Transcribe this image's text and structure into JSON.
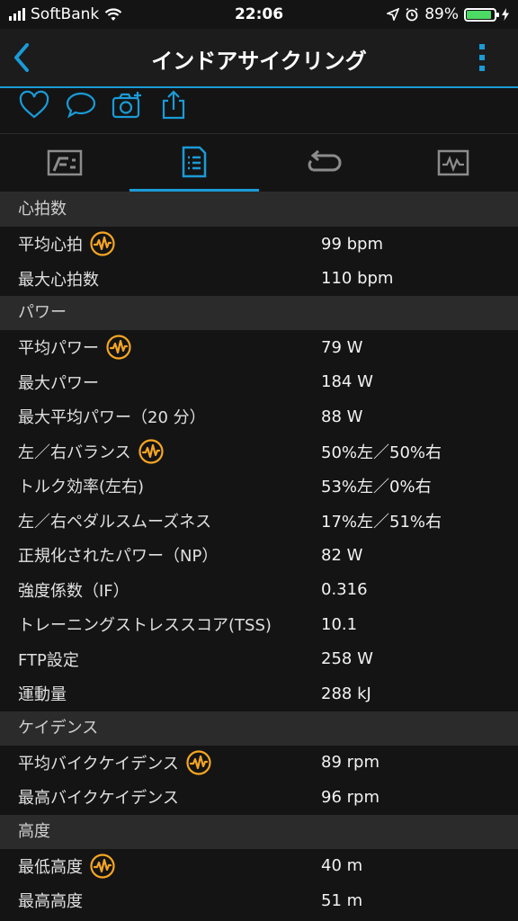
{
  "status_bar": {
    "carrier": "SoftBank",
    "time": "22:06",
    "battery": "89%"
  },
  "nav": {
    "title": "インドアサイクリング"
  },
  "icons": {
    "back": "chevron-left-icon",
    "more": "more-vertical-icon",
    "like": "heart-icon",
    "comment": "speech-bubble-icon",
    "photo": "add-photo-icon",
    "share": "share-icon",
    "tab_overview": "overview-icon",
    "tab_stats": "stats-list-icon",
    "tab_laps": "laps-icon",
    "tab_charts": "charts-icon",
    "badge": "insight-badge-icon"
  },
  "colors": {
    "accent": "#1a9bd7",
    "badge": "#f5a623",
    "section_bg": "#2b2b2b"
  },
  "sections": [
    {
      "title": "心拍数",
      "rows": [
        {
          "label": "平均心拍",
          "value": "99 bpm",
          "badge": true
        },
        {
          "label": "最大心拍数",
          "value": "110 bpm",
          "badge": false
        }
      ]
    },
    {
      "title": "パワー",
      "rows": [
        {
          "label": "平均パワー",
          "value": "79 W",
          "badge": true
        },
        {
          "label": "最大パワー",
          "value": "184 W",
          "badge": false
        },
        {
          "label": "最大平均パワー（20 分）",
          "value": "88 W",
          "badge": false
        },
        {
          "label": "左／右バランス",
          "value": "50%左／50%右",
          "badge": true
        },
        {
          "label": "トルク効率(左右)",
          "value": "53%左／0%右",
          "badge": false
        },
        {
          "label": "左／右ペダルスムーズネス",
          "value": "17%左／51%右",
          "badge": false
        },
        {
          "label": "正規化されたパワー（NP）",
          "value": "82 W",
          "badge": false
        },
        {
          "label": "強度係数（IF）",
          "value": "0.316",
          "badge": false
        },
        {
          "label": "トレーニングストレススコア(TSS)",
          "value": "10.1",
          "badge": false
        },
        {
          "label": "FTP設定",
          "value": "258 W",
          "badge": false
        },
        {
          "label": "運動量",
          "value": "288 kJ",
          "badge": false
        }
      ]
    },
    {
      "title": "ケイデンス",
      "rows": [
        {
          "label": "平均バイクケイデンス",
          "value": "89 rpm",
          "badge": true
        },
        {
          "label": "最高バイクケイデンス",
          "value": "96 rpm",
          "badge": false
        }
      ]
    },
    {
      "title": "高度",
      "rows": [
        {
          "label": "最低高度",
          "value": "40 m",
          "badge": true
        },
        {
          "label": "最高高度",
          "value": "51 m",
          "badge": false
        }
      ]
    }
  ]
}
